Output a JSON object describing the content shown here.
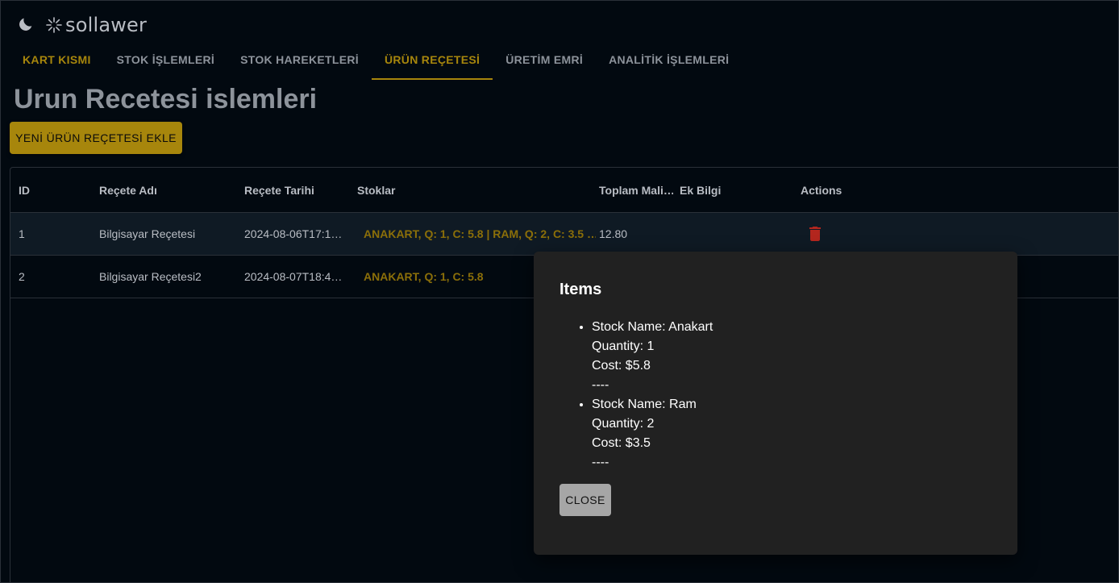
{
  "app": {
    "logo_text": "sollawer",
    "theme_icon": "moon-icon",
    "logo_icon": "sunburst-icon"
  },
  "tabs": [
    {
      "label": "KART KISMI",
      "state": "highlight"
    },
    {
      "label": "STOK İŞLEMLERİ",
      "state": "normal"
    },
    {
      "label": "STOK HAREKETLERİ",
      "state": "normal"
    },
    {
      "label": "ÜRÜN REÇETESİ",
      "state": "active"
    },
    {
      "label": "ÜRETİM EMRİ",
      "state": "normal"
    },
    {
      "label": "ANALİTİK İŞLEMLERİ",
      "state": "normal"
    }
  ],
  "page": {
    "title": "Urun Recetesi islemleri",
    "add_button": "YENİ ÜRÜN REÇETESİ EKLE"
  },
  "table": {
    "columns": [
      "ID",
      "Reçete Adı",
      "Reçete Tarihi",
      "Stoklar",
      "Toplam Mali…",
      "Ek Bilgi",
      "Actions"
    ],
    "rows": [
      {
        "id": "1",
        "name": "Bilgisayar Reçetesi",
        "date": "2024-08-06T17:1…",
        "stocks": "ANAKART, Q: 1, C: 5.8 | RAM, Q: 2, C: 3.5 …",
        "total": "12.80",
        "info": "",
        "has_delete": true
      },
      {
        "id": "2",
        "name": "Bilgisayar Reçetesi2",
        "date": "2024-08-07T18:4…",
        "stocks": "ANAKART, Q: 1, C: 5.8",
        "total": "",
        "info": "",
        "has_delete": false
      }
    ]
  },
  "modal": {
    "title": "Items",
    "items": [
      {
        "name_line": "Stock Name: Anakart",
        "qty_line": "Quantity: 1",
        "cost_line": "Cost: $5.8",
        "sep": "----"
      },
      {
        "name_line": "Stock Name: Ram",
        "qty_line": "Quantity: 2",
        "cost_line": "Cost: $3.5",
        "sep": "----"
      }
    ],
    "close_label": "CLOSE"
  },
  "colors": {
    "background": "#020910",
    "accent": "#a7860c",
    "delete": "#b3261e",
    "modal_bg": "#212121"
  }
}
